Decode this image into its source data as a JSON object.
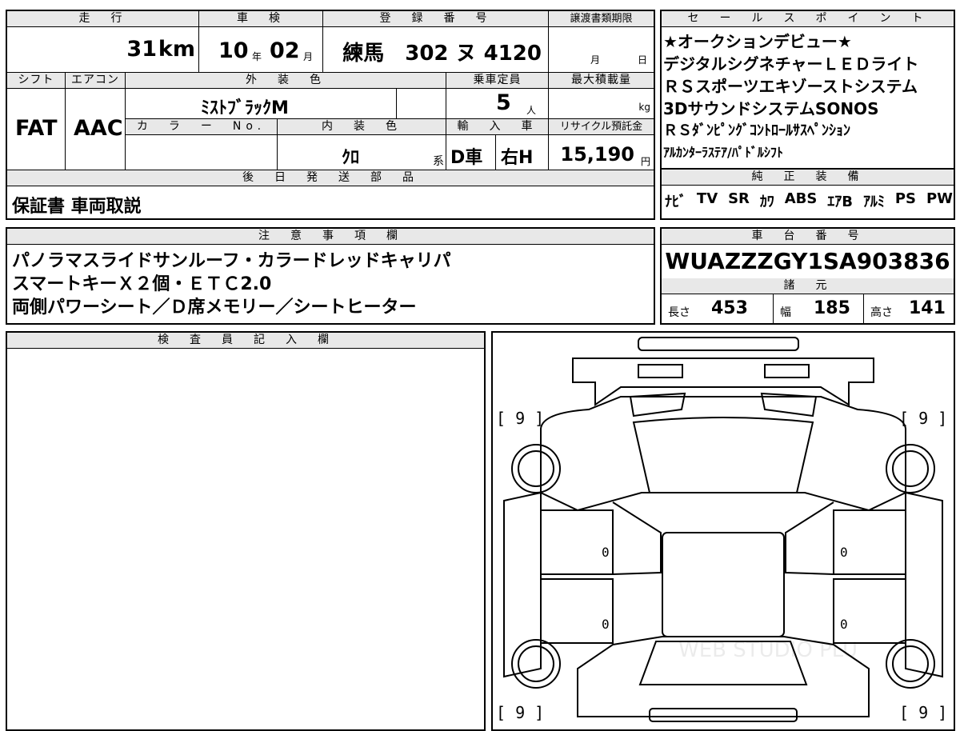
{
  "top_left": {
    "headers": {
      "mileage": "走　行",
      "inspection": "車　検",
      "registration": "登　録　番　号",
      "transfer": "譲渡書類期限",
      "shift": "シフト",
      "aircon": "エアコン",
      "exterior_color": "外　装　色",
      "capacity": "乗車定員",
      "max_load": "最大積載量",
      "color_no": "カ　ラ　ー　No.",
      "interior_color": "内　装　色",
      "import": "輸　入　車",
      "recycle": "リサイクル預託金",
      "later_parts": "後　日　発　送　部　品"
    },
    "mileage_value": "31",
    "mileage_unit": "km",
    "inspection_year": "10",
    "year_unit": "年",
    "inspection_month": "02",
    "month_unit": "月",
    "registration_value": "練馬　302 ヌ 4120",
    "transfer_month_unit": "月",
    "transfer_day_unit": "日",
    "shift_value": "FAT",
    "aircon_value": "AAC",
    "exterior_color_value": "ﾐｽﾄﾌﾞﾗｯｸM",
    "capacity_value": "5",
    "capacity_unit": "人",
    "max_load_unit": "kg",
    "interior_color_value": "ｸﾛ",
    "interior_suffix": "系",
    "import_d": "D車",
    "import_h": "右H",
    "recycle_value": "15,190",
    "recycle_unit": "円",
    "later_parts_value": "保証書 車両取説"
  },
  "sales_points": {
    "header": "セ　ー　ル　ス　ポ　イ　ン　ト",
    "lines": [
      "★オークションデビュー★",
      "デジタルシグネチャーＬＥＤライト",
      "ＲＳスポーツエキゾーストシステム",
      "3DサウンドシステムSONOS",
      "ＲＳﾀﾞﾝﾋﾟﾝｸﾞｺﾝﾄﾛｰﾙｻｽﾍﾟﾝｼｮﾝ",
      "ｱﾙｶﾝﾀｰﾗｽﾃｱ/ﾊﾟﾄﾞﾙｼﾌﾄ"
    ]
  },
  "genuine_equipment": {
    "header": "純　正　装　備",
    "items": [
      "ﾅﾋﾞ",
      "TV",
      "SR",
      "ｶﾜ",
      "ABS",
      "ｴｱB",
      "ｱﾙﾐ",
      "PS",
      "PW"
    ]
  },
  "notes": {
    "header": "注　意　事　項　欄",
    "lines": [
      "パノラマスライドサンルーフ・カラードレッドキャリパ",
      "スマートキーＸ２個・ＥＴＣ2.0",
      "両側パワーシート／Ｄ席メモリー／シートヒーター"
    ]
  },
  "chassis": {
    "header": "車　台　番　号",
    "value": "WUAZZZGY1SA903836"
  },
  "specs": {
    "header": "諸　元",
    "length_label": "長さ",
    "length": "453",
    "width_label": "幅",
    "width": "185",
    "height_label": "高さ",
    "height": "141"
  },
  "inspector": {
    "header": "検　査　員　記　入　欄"
  },
  "diagram": {
    "corner_labels": [
      "[ 9 ]",
      "[ 9 ]",
      "[ 9 ]",
      "[ 9 ]"
    ],
    "door_values": [
      "0",
      "0",
      "0",
      "0"
    ],
    "watermark": "WEB STUDIO PLU"
  }
}
